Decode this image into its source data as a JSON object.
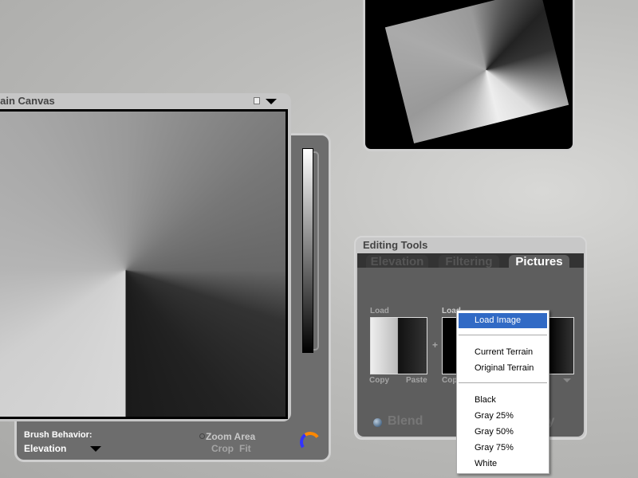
{
  "canvas_window": {
    "title": "rrain Canvas"
  },
  "brush": {
    "label": "Brush Behavior:",
    "value": "Elevation"
  },
  "zoom": {
    "zoom_area": "Zoom Area",
    "crop": "Crop",
    "fit": "Fit"
  },
  "editing_tools": {
    "title": "Editing Tools",
    "tabs": [
      "Elevation",
      "Filtering",
      "Pictures"
    ],
    "active_tab": "Pictures",
    "load1": "Load",
    "load2": "Load",
    "copy1": "Copy",
    "paste1": "Paste",
    "copy2": "Cop",
    "blend": "Blend",
    "apply_partial": "ly",
    "plus": "+"
  },
  "menu": {
    "items": [
      "Load Image",
      "Current Terrain",
      "Original Terrain",
      "Black",
      "Gray 25%",
      "Gray 50%",
      "Gray 75%",
      "White"
    ],
    "highlight_color": "#316ac5"
  }
}
